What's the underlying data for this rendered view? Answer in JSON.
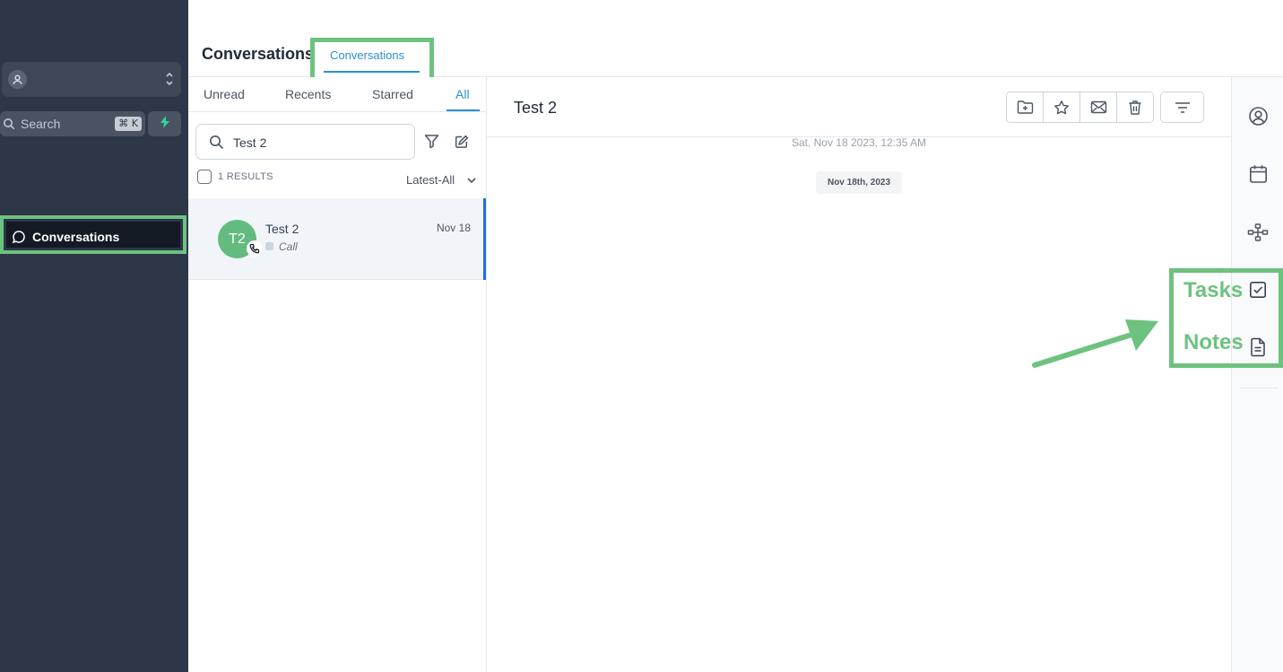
{
  "sidebar": {
    "search_label": "Search",
    "search_shortcut": "⌘ K",
    "nav_conversations": "Conversations",
    "icons": {
      "account": "user-circle-icon",
      "switch": "chevron-up-down-icon",
      "search": "search-icon",
      "quick_action": "lightning-icon",
      "conversations": "chat-bubble-icon"
    }
  },
  "header": {
    "title": "Conversations",
    "active_tab": "Conversations"
  },
  "conversation_list": {
    "filters": [
      "Unread",
      "Recents",
      "Starred",
      "All"
    ],
    "active_filter": "All",
    "search_value": "Test 2",
    "results_count": "1 RESULTS",
    "sort_label": "Latest-All",
    "items": [
      {
        "initials": "T2",
        "name": "Test 2",
        "date": "Nov 18",
        "type": "Call"
      }
    ],
    "icons": {
      "search": "search-icon",
      "filter": "funnel-icon",
      "compose": "compose-icon",
      "sort": "chevron-down-icon",
      "badge": "phone-icon"
    }
  },
  "chat": {
    "title": "Test 2",
    "timestamp": "Sat, Nov 18 2023, 12:35 AM",
    "date_separator": "Nov 18th, 2023",
    "actions": [
      "folder-plus-icon",
      "star-icon",
      "envelope-icon",
      "trash-icon"
    ],
    "sort_icon": "sort-lines-icon"
  },
  "right_rail": {
    "icons": [
      "contact-icon",
      "calendar-icon",
      "network-icon",
      "tasks-icon",
      "notes-icon"
    ]
  },
  "annotation": {
    "tasks": "Tasks",
    "notes": "Notes",
    "color": "#6ec27f"
  },
  "colors": {
    "sidebar_bg": "#2d3748",
    "accent": "#2b8fd3",
    "selected_bar": "#1d6fd8",
    "avatar": "#64bb7f",
    "highlight": "#6ec27f"
  }
}
